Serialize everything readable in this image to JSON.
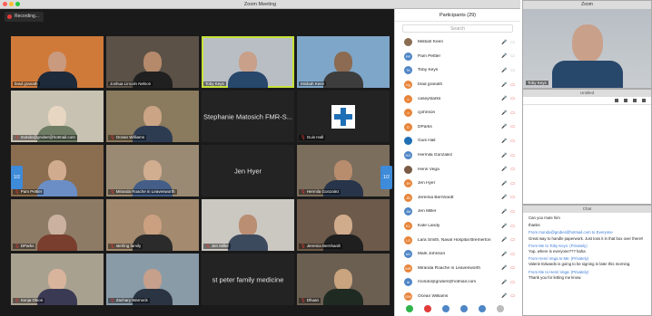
{
  "window": {
    "title": "Zoom Meeting"
  },
  "recording": {
    "label": "Recording..."
  },
  "pager": {
    "left_label": "1/2",
    "right_label": "1/2"
  },
  "tiles": [
    {
      "name": "brad granath",
      "kind": "video",
      "bg": "#d07a3a",
      "skin": "#c99a7e",
      "shirt": "#1d2a3a",
      "muted": false
    },
    {
      "name": "Joshua Lincoln Nelson",
      "kind": "video",
      "bg": "#5b5147",
      "skin": "#b58a6b",
      "shirt": "#202020",
      "muted": false
    },
    {
      "name": "Toby Keys",
      "kind": "video",
      "bg": "#b8bec4",
      "skin": "#c9a08a",
      "shirt": "#27476b",
      "muted": false,
      "active": true
    },
    {
      "name": "Misbah Keen",
      "kind": "video",
      "bg": "#7ea6c9",
      "skin": "#8c6b52",
      "shirt": "#3d3d3d",
      "muted": false
    },
    {
      "name": "mondo@gruber@hotmail.com",
      "kind": "video",
      "bg": "#c8c2b2",
      "skin": "#e6d6c2",
      "shirt": "#6f7d64",
      "muted": true
    },
    {
      "name": "Ocean Williams",
      "kind": "video",
      "bg": "#8a7a5e",
      "skin": "#caa484",
      "shirt": "#2e3c52",
      "muted": true
    },
    {
      "name": "Stephanie Matosich FMR-S...",
      "kind": "name",
      "muted": true
    },
    {
      "name": "Guis Hall",
      "kind": "cross",
      "muted": true
    },
    {
      "name": "Pam Pettler",
      "kind": "video",
      "bg": "#8b6d4f",
      "skin": "#d1ab8d",
      "shirt": "#6b8ec7",
      "muted": true
    },
    {
      "name": "Miranda Roache in Leavenworth",
      "kind": "video",
      "bg": "#9b8a73",
      "skin": "#d2ae91",
      "shirt": "#445e87",
      "muted": true
    },
    {
      "name": "Jen Hyer",
      "kind": "name",
      "muted": true
    },
    {
      "name": "Hermila Gonzalez",
      "kind": "video",
      "bg": "#7c6e5d",
      "skin": "#b88d6e",
      "shirt": "#273449",
      "muted": true
    },
    {
      "name": "DParks",
      "kind": "video",
      "bg": "#8d7b66",
      "skin": "#cbb1a0",
      "shirt": "#7a3e2e",
      "muted": true
    },
    {
      "name": "sterling family",
      "kind": "video",
      "bg": "#a48a6e",
      "skin": "#caa080",
      "shirt": "#2b2b2b",
      "muted": true
    },
    {
      "name": "Jen Miller",
      "kind": "video",
      "bg": "#cbc7c1",
      "skin": "#b98e72",
      "shirt": "#3c4a5e",
      "muted": true
    },
    {
      "name": "Jeremia Bernhardt",
      "kind": "video",
      "bg": "#6d5a4a",
      "skin": "#d0ab8c",
      "shirt": "#1f1f1f",
      "muted": true
    },
    {
      "name": "Sonja Olson",
      "kind": "video",
      "bg": "#a9a190",
      "skin": "#d9b49c",
      "shirt": "#3a3a54",
      "muted": true
    },
    {
      "name": "Zachary Warnock",
      "kind": "video",
      "bg": "#8a9ba8",
      "skin": "#c6a08b",
      "shirt": "#2b3442",
      "muted": true
    },
    {
      "name": "st peter family medicine",
      "kind": "name",
      "muted": true
    },
    {
      "name": "Dhuan",
      "kind": "video",
      "bg": "#6b5f52",
      "skin": "#caa47f",
      "shirt": "#1f2a22",
      "muted": true
    }
  ],
  "participants": {
    "title": "Participants (29)",
    "search_placeholder": "Search",
    "items": [
      {
        "name": "Misbah Keen",
        "initials": "",
        "color": "#8a6d52",
        "muted": false
      },
      {
        "name": "Pam Pettler",
        "initials": "PP",
        "color": "#4f86c6",
        "muted": false
      },
      {
        "name": "Toby Keys",
        "initials": "TK",
        "color": "#4f86c6",
        "muted": false
      },
      {
        "name": "brad granath",
        "initials": "bg",
        "color": "#e8853a",
        "muted": true
      },
      {
        "name": "caseystarks",
        "initials": "c",
        "color": "#e8853a",
        "muted": true
      },
      {
        "name": "cjohnson",
        "initials": "c",
        "color": "#e8853a",
        "muted": true
      },
      {
        "name": "DParks",
        "initials": "D",
        "color": "#e8853a",
        "muted": true
      },
      {
        "name": "Guis Hall",
        "initials": "",
        "color": "#1f6fb6",
        "muted": true
      },
      {
        "name": "Hermila Gonzalez",
        "initials": "HG",
        "color": "#4f86c6",
        "muted": true
      },
      {
        "name": "Henri Vega",
        "initials": "",
        "color": "#7a5c46",
        "muted": true
      },
      {
        "name": "Jen Hyer",
        "initials": "JH",
        "color": "#e8853a",
        "muted": true
      },
      {
        "name": "Jeremia Bernhardt",
        "initials": "JB",
        "color": "#e8853a",
        "muted": true
      },
      {
        "name": "Jen Miller",
        "initials": "JM",
        "color": "#4f86c6",
        "muted": true
      },
      {
        "name": "Kate Landy",
        "initials": "KL",
        "color": "#e8853a",
        "muted": true
      },
      {
        "name": "Lara Smith, Naval Hospital Bremerton",
        "initials": "LS",
        "color": "#e8853a",
        "muted": true
      },
      {
        "name": "Mark Johnson",
        "initials": "MJ",
        "color": "#4f86c6",
        "muted": true
      },
      {
        "name": "Miranda Roache in Leavenworth",
        "initials": "MR",
        "color": "#e8853a",
        "muted": true
      },
      {
        "name": "mondo@gruber@hotmail.com",
        "initials": "m",
        "color": "#4f86c6",
        "muted": true
      },
      {
        "name": "Ocean Williams",
        "initials": "OW",
        "color": "#e8853a",
        "muted": true
      }
    ]
  },
  "self_view": {
    "title": "Zoom",
    "name": "Toby Keys"
  },
  "whiteboard": {
    "title": "Untitled"
  },
  "chat": {
    "title": "Chat",
    "messages": [
      {
        "meta": "",
        "text": "Can you mute him"
      },
      {
        "meta": "",
        "text": "thanks"
      },
      {
        "meta": "From mondo@gruber@hotmail.com to Everyone",
        "text": "Great way to handle paperwork. Just toss it in that box over there!!"
      },
      {
        "meta": "From Me to Toby Keys: (Privately)",
        "text": "Yup, where is everyone??? haha"
      },
      {
        "meta": "From Henri Vega to Me: (Privately)",
        "text": "Valerie Edwards is going to be signing in later this morning."
      },
      {
        "meta": "From Me to Henri Vega: (Privately)",
        "text": "Thank you for letting me know."
      }
    ]
  }
}
